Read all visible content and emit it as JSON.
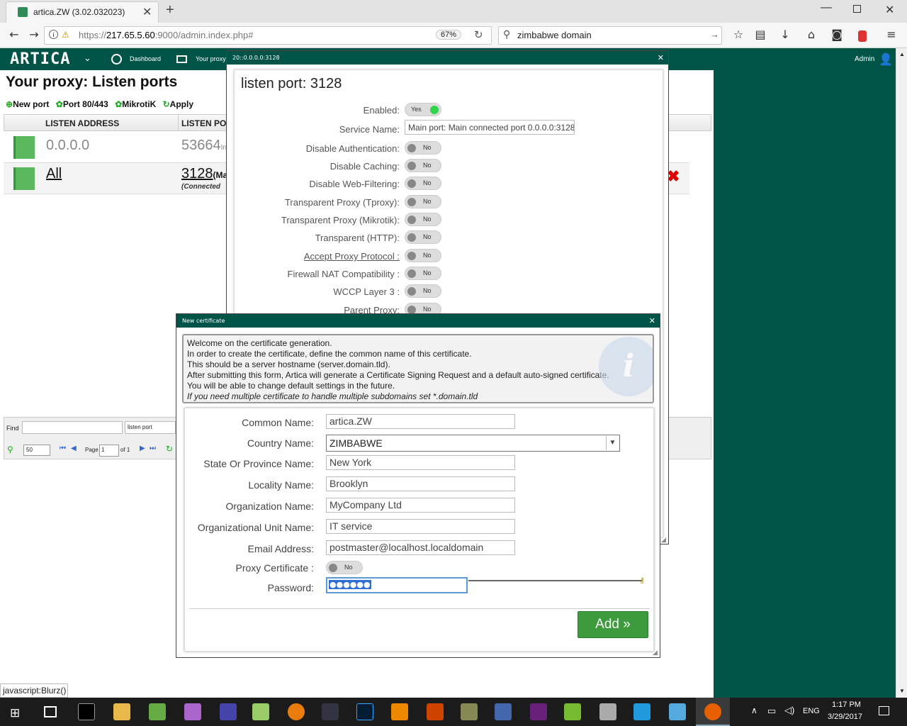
{
  "browser": {
    "tab_title": "artica.ZW (3.02.032023)",
    "url_prefix": "https://",
    "url_host": "217.65.5.60",
    "url_rest": ":9000/admin.index.php#",
    "zoom": "67%",
    "search_value": "zimbabwe domain",
    "status_text": "javascript:Blurz()"
  },
  "header": {
    "logo": "ARTICA",
    "nav_dashboard": "Dashboard",
    "nav_proxy": "Your proxy",
    "user": "Admin"
  },
  "page": {
    "title": "Your proxy: Listen ports",
    "toolbar": [
      "New port",
      "Port 80/443",
      "MikrotiK",
      "Apply"
    ],
    "columns": [
      "LISTEN ADDRESS",
      "LISTEN POI"
    ],
    "rows": [
      {
        "address": "0.0.0.0",
        "port": "53664",
        "port_suffix": "In",
        "note": ""
      },
      {
        "address": "All",
        "port": "3128",
        "port_suffix": "(Ma",
        "note": "(Connected"
      }
    ],
    "find_label": "Find",
    "find_select": "listen port",
    "per_page": "50",
    "page_label": "Page",
    "page_value": "1",
    "page_of": "of 1"
  },
  "dialog1": {
    "title": "20::0.0.0.0:3128",
    "heading": "listen port: 3128",
    "fields": [
      {
        "label": "Enabled:",
        "value": "Yes",
        "on": true
      },
      {
        "label": "Service Name:",
        "input": "Main port: Main connected port 0.0.0.0:3128"
      },
      {
        "label": "Disable Authentication:",
        "value": "No"
      },
      {
        "label": "Disable Caching:",
        "value": "No"
      },
      {
        "label": "Disable Web-Filtering:",
        "value": "No"
      },
      {
        "label": "Transparent Proxy (Tproxy):",
        "value": "No"
      },
      {
        "label": "Transparent Proxy (Mikrotik):",
        "value": "No"
      },
      {
        "label": "Transparent (HTTP):",
        "value": "No"
      },
      {
        "label": "Accept Proxy Protocol :",
        "value": "No",
        "underline": true
      },
      {
        "label": "Firewall NAT Compatibility :",
        "value": "No"
      },
      {
        "label": "WCCP Layer 3 :",
        "value": "No"
      },
      {
        "label": "Parent Proxy:",
        "value": "No"
      }
    ]
  },
  "dialog2": {
    "title": "New certificate",
    "info_lines": [
      "Welcome on the certificate generation.",
      "In order to create the certificate, define the common name of this certificate.",
      "This should be a server hostname (server.domain.tld).",
      "After submitting this form, Artica will generate a Certificate Signing Request and a default auto-signed certificate.",
      "You will be able to change default settings in the future."
    ],
    "info_italic": "If you need multiple certificate to handle multiple subdomains set *.domain.tld",
    "common_name_label": "Common Name:",
    "common_name": "artica.ZW",
    "country_label": "Country Name:",
    "country": "ZIMBABWE",
    "state_label": "State Or Province Name:",
    "state": "New York",
    "locality_label": "Locality Name:",
    "locality": "Brooklyn",
    "org_label": "Organization Name:",
    "org": "MyCompany Ltd",
    "ou_label": "Organizational Unit Name:",
    "ou": "IT service",
    "email_label": "Email Address:",
    "email": "postmaster@localhost.localdomain",
    "proxy_cert_label": "Proxy Certificate :",
    "proxy_cert": "No",
    "password_label": "Password:",
    "password_mask": "●●●●●●",
    "add_button": "Add »"
  },
  "taskbar": {
    "lang": "ENG",
    "time": "1:17 PM",
    "date": "3/29/2017"
  }
}
